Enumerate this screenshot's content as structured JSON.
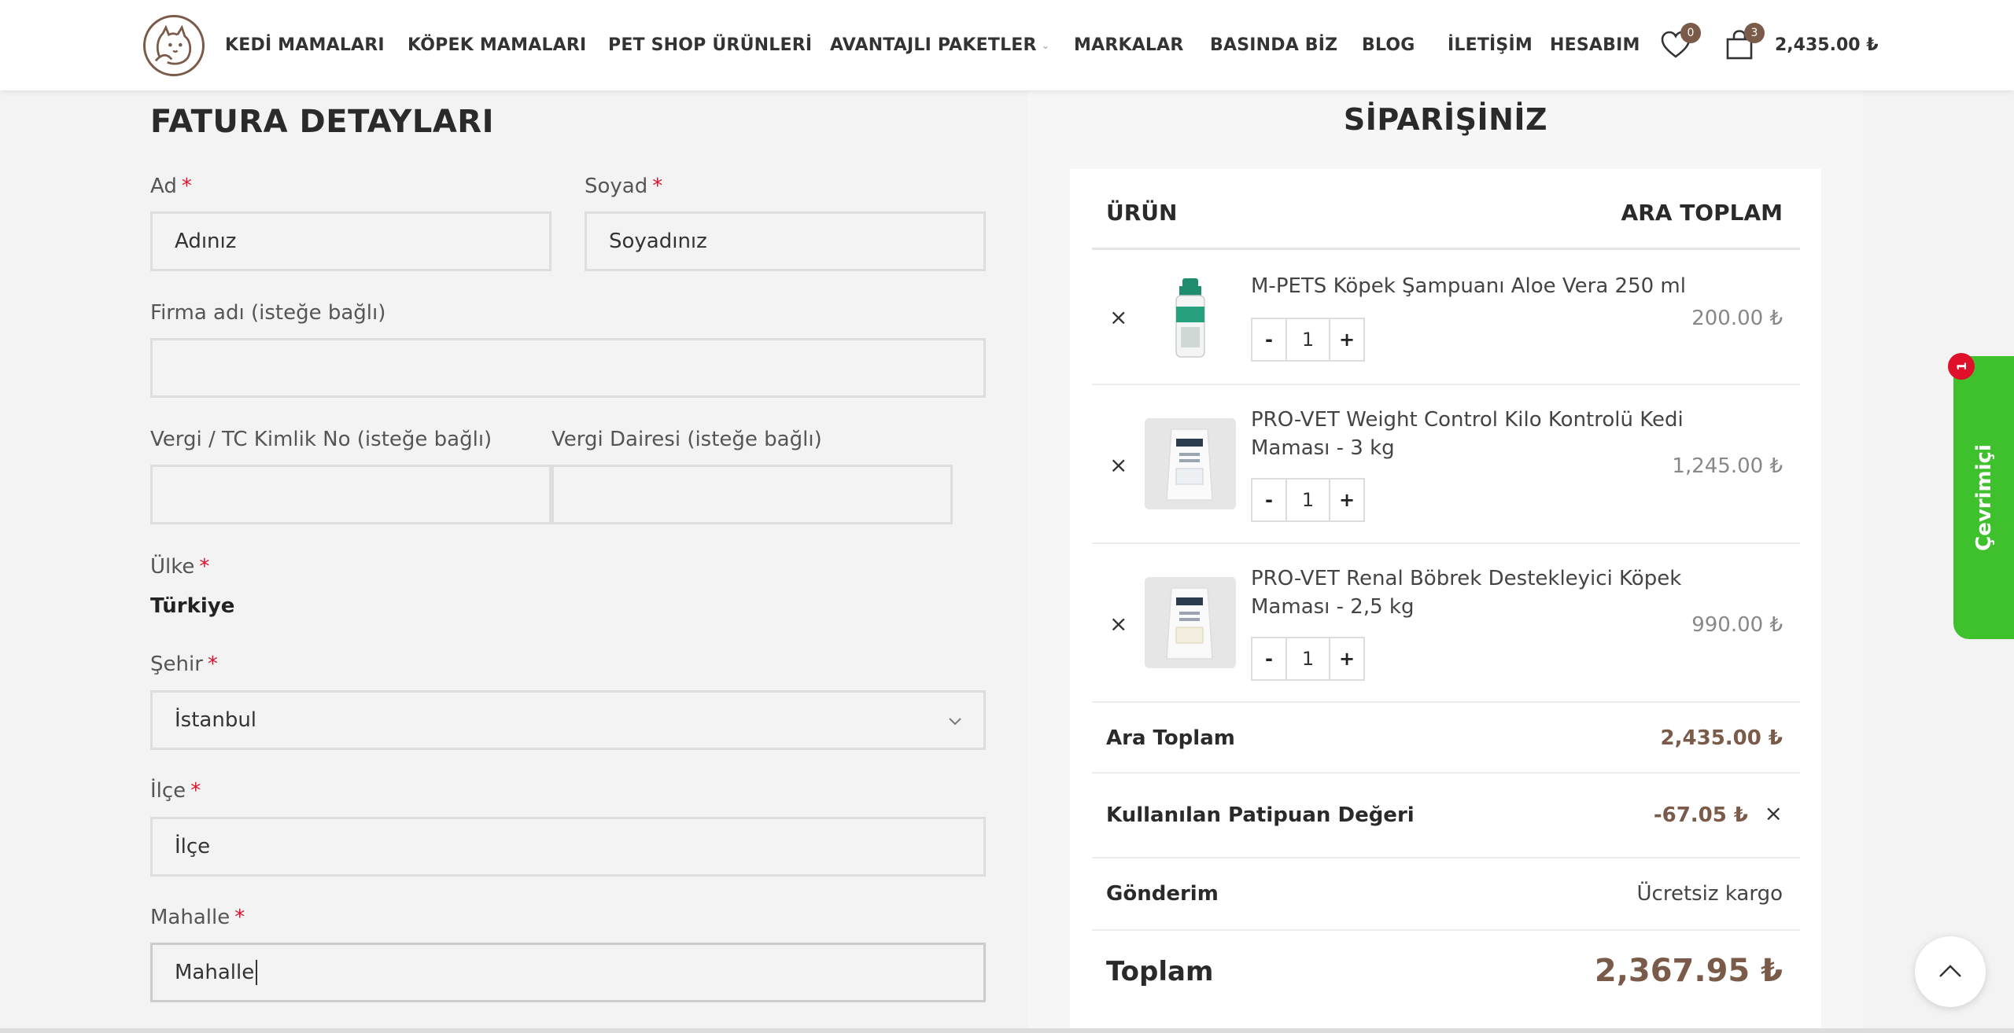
{
  "header": {
    "nav": [
      {
        "label": "KEDİ MAMALARI"
      },
      {
        "label": "KÖPEK MAMALARI"
      },
      {
        "label": "PET SHOP ÜRÜNLERİ"
      },
      {
        "label": "AVANTAJLI PAKETLER",
        "has_dropdown": true
      },
      {
        "label": "MARKALAR"
      },
      {
        "label": "BASINDA BİZ"
      },
      {
        "label": "BLOG"
      },
      {
        "label": "İLETİŞİM"
      },
      {
        "label": "HESABIM"
      }
    ],
    "wishlist_count": "0",
    "cart_count": "3",
    "cart_total": "2,435.00 ₺",
    "icons": {
      "logo": "cat-dog-logo",
      "wishlist": "heart-icon",
      "cart": "shopping-bag-icon"
    }
  },
  "billing": {
    "title": "FATURA DETAYLARI",
    "required_mark": "*",
    "first_name": {
      "label": "Ad",
      "placeholder": "Adınız"
    },
    "last_name": {
      "label": "Soyad",
      "placeholder": "Soyadınız"
    },
    "company": {
      "label": "Firma adı (isteğe bağlı)",
      "value": ""
    },
    "tax_id": {
      "label": "Vergi / TC Kimlik No (isteğe bağlı)",
      "value": ""
    },
    "tax_office": {
      "label": "Vergi Dairesi (isteğe bağlı)",
      "value": ""
    },
    "country": {
      "label": "Ülke",
      "value": "Türkiye"
    },
    "city": {
      "label": "Şehir",
      "value": "İstanbul"
    },
    "district": {
      "label": "İlçe",
      "placeholder": "İlçe"
    },
    "neighborhood": {
      "label": "Mahalle",
      "value": "Mahalle"
    }
  },
  "order": {
    "title": "SİPARİŞİNİZ",
    "col_product": "ÜRÜN",
    "col_subtotal": "ARA TOPLAM",
    "remove_symbol": "×",
    "qty_minus": "-",
    "qty_plus": "+",
    "items": [
      {
        "name": "M-PETS Köpek Şampuanı Aloe Vera 250 ml",
        "qty": "1",
        "price": "200.00 ₺"
      },
      {
        "name": "PRO-VET Weight Control Kilo Kontrolü Kedi Maması - 3 kg",
        "qty": "1",
        "price": "1,245.00 ₺"
      },
      {
        "name": "PRO-VET Renal Böbrek Destekleyici Köpek Maması - 2,5 kg",
        "qty": "1",
        "price": "990.00 ₺"
      }
    ],
    "subtotal_label": "Ara Toplam",
    "subtotal_value": "2,435.00 ₺",
    "discount_label": "Kullanılan Patipuan Değeri",
    "discount_value": "-67.05 ₺",
    "shipping_label": "Gönderim",
    "shipping_value": "Ücretsiz kargo",
    "total_label": "Toplam",
    "total_value": "2,367.95 ₺"
  },
  "chat": {
    "label": "Çevrimiçi",
    "badge": "1"
  },
  "colors": {
    "brand": "#7a5a48",
    "required": "#e0102b",
    "chat": "#3fc12e"
  }
}
